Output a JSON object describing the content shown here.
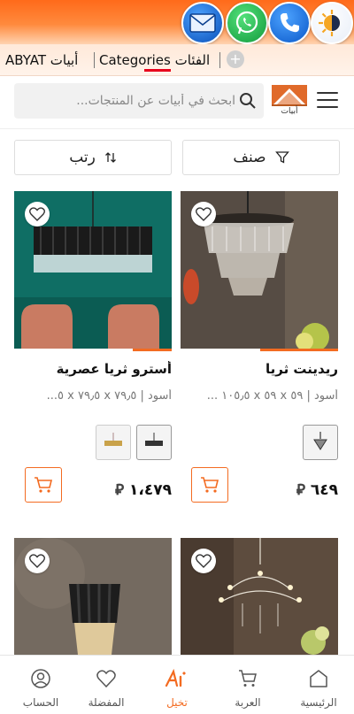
{
  "floating_actions": {
    "mail": "mail-icon",
    "whatsapp": "whatsapp-icon",
    "phone": "phone-icon",
    "theme": "theme-toggle-icon"
  },
  "breadcrumb": {
    "abyat": "ABYAT أبيات",
    "categories": "Categories الفئات"
  },
  "header": {
    "logo_text": "أبيات",
    "search_placeholder": "ابحث في أبيات عن المنتجات..."
  },
  "toolbar": {
    "filter_label": "صنف",
    "sort_label": "رتب"
  },
  "products": [
    {
      "title": "ريدينت ثريا",
      "subtitle": "أسود | ٥٩ x ٥٩ x ١٠٥٫٥ ...",
      "price": "٦٤٩",
      "currency": "ر.س"
    },
    {
      "title": "أسترو ثريا عصرية",
      "subtitle": "أسود | ٧٩٫٥ x ٧٩٫٥ x ٥...",
      "price": "١،٤٧٩",
      "currency": "ر.س"
    },
    {
      "title": "",
      "subtitle": "",
      "price": ""
    },
    {
      "title": "",
      "subtitle": "",
      "price": ""
    }
  ],
  "bottom_nav": {
    "home": "الرئيسية",
    "cart": "العربة",
    "imagine": "تخيل",
    "favorites": "المفضلة",
    "account": "الحساب"
  },
  "colors": {
    "accent": "#f36b21",
    "tab_underline": "#e8001c"
  }
}
